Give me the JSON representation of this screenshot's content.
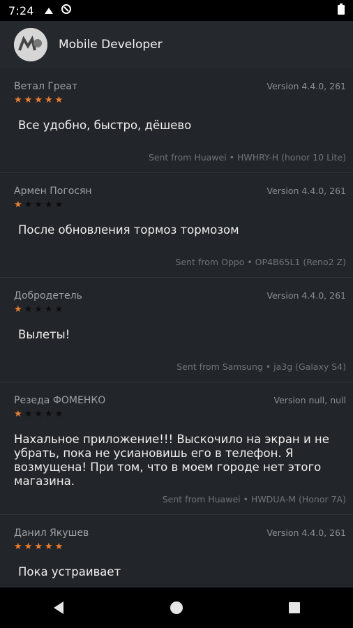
{
  "status_bar": {
    "time": "7:24"
  },
  "header": {
    "title": "Mobile Developer",
    "avatar_initials": "M"
  },
  "reviews": [
    {
      "author": "Ветал Греат",
      "version": "Version 4.4.0, 261",
      "rating": 5,
      "text": "Все удобно, быстро, дёшево",
      "device": "Sent from Huawei • HWHRY-H (honor 10 Lite)"
    },
    {
      "author": "Армен Погосян",
      "version": "Version 4.4.0, 261",
      "rating": 1,
      "text": "После обновления тормоз тормозом",
      "device": "Sent from Oppo • OP4B65L1 (Reno2 Z)"
    },
    {
      "author": "Добродетель",
      "version": "Version 4.4.0, 261",
      "rating": 1,
      "text": "Вылеты!",
      "device": "Sent from Samsung • ja3g (Galaxy S4)"
    },
    {
      "author": "Резеда ФОМЕНКО",
      "version": "Version null, null",
      "rating": 1,
      "text": " Нахальное приложение!!! Выскочило на экран и не убрать, пока не усиановишь его в телефон. Я возмущена! При том, что в моем городе нет этого магазина.",
      "device": "Sent from Huawei • HWDUA-M (Honor 7A)"
    },
    {
      "author": "Данил Якушев",
      "version": "Version 4.4.0, 261",
      "rating": 5,
      "text": "Пока устраивает",
      "device": ""
    }
  ],
  "colors": {
    "star_filled": "#f07d2c",
    "star_empty": "#0b0c0e",
    "background": "#222529"
  }
}
